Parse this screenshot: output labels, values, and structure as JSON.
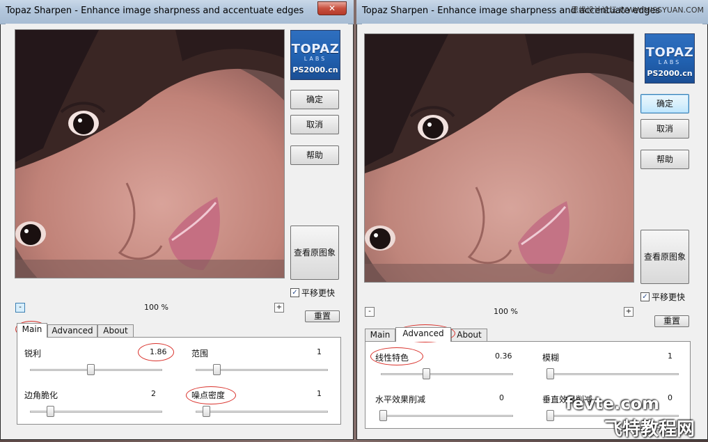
{
  "window": {
    "title": "Topaz Sharpen - Enhance image sharpness and accentuate edges",
    "close_glyph": "✕"
  },
  "watermark_top_right": "思缘设计论坛 WWW.MISSYUAN.COM",
  "logo": {
    "topaz": "TOPAZ",
    "labs": "LABS",
    "ps": "PS2000.cn"
  },
  "buttons": {
    "ok": "确定",
    "cancel": "取消",
    "help": "帮助",
    "view_original": "查看原图象",
    "reset": "重置"
  },
  "checkbox": {
    "label": "平移更快",
    "checked": true,
    "glyph": "✓"
  },
  "zoom": {
    "minus": "-",
    "plus": "+",
    "level": "100 %"
  },
  "tabs": [
    "Main",
    "Advanced",
    "About"
  ],
  "left_panel": {
    "active_tab": "Main",
    "params": [
      {
        "label": "锐利",
        "value": "1.86",
        "slider_fraction": 0.48
      },
      {
        "label": "范围",
        "value": "1",
        "slider_fraction": 0.15
      },
      {
        "label": "边角脆化",
        "value": "2",
        "slider_fraction": 0.15
      },
      {
        "label": "噪点密度",
        "value": "1",
        "slider_fraction": 0.08
      }
    ]
  },
  "right_panel": {
    "active_tab": "Advanced",
    "params": [
      {
        "label": "线性特色",
        "value": "0.36",
        "slider_fraction": 0.36
      },
      {
        "label": "模糊",
        "value": "1",
        "slider_fraction": 0.02
      },
      {
        "label": "水平效果削减",
        "value": "0",
        "slider_fraction": 0.02
      },
      {
        "label": "垂直效果削减",
        "value": "0",
        "slider_fraction": 0.02
      }
    ]
  },
  "site_watermark": {
    "line1": "fevte.com",
    "line2": "飞特教程网"
  }
}
